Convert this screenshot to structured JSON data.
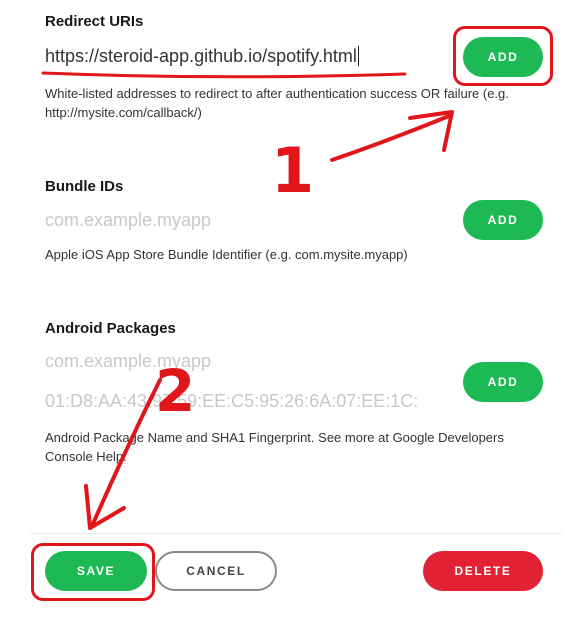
{
  "redirect": {
    "label": "Redirect URIs",
    "value": "https://steroid-app.github.io/spotify.html",
    "add_label": "ADD",
    "help": "White-listed addresses to redirect to after authentication success OR failure (e.g. http://mysite.com/callback/)"
  },
  "bundle": {
    "label": "Bundle IDs",
    "placeholder": "com.example.myapp",
    "add_label": "ADD",
    "help": "Apple iOS App Store Bundle Identifier (e.g. com.mysite.myapp)"
  },
  "android": {
    "label": "Android Packages",
    "package_placeholder": "com.example.myapp",
    "fingerprint_placeholder": "01:D8:AA:43:97:59:EE:C5:95:26:6A:07:EE:1C:",
    "add_label": "ADD",
    "help": "Android Package Name and SHA1 Fingerprint. See more at Google Developers Console Help."
  },
  "footer": {
    "save_label": "SAVE",
    "cancel_label": "CANCEL",
    "delete_label": "DELETE"
  },
  "annotations": {
    "step1": "1",
    "step2": "2",
    "color": "#e0161b"
  },
  "colors": {
    "accent_green": "#1db954",
    "danger_red": "#e22134"
  }
}
